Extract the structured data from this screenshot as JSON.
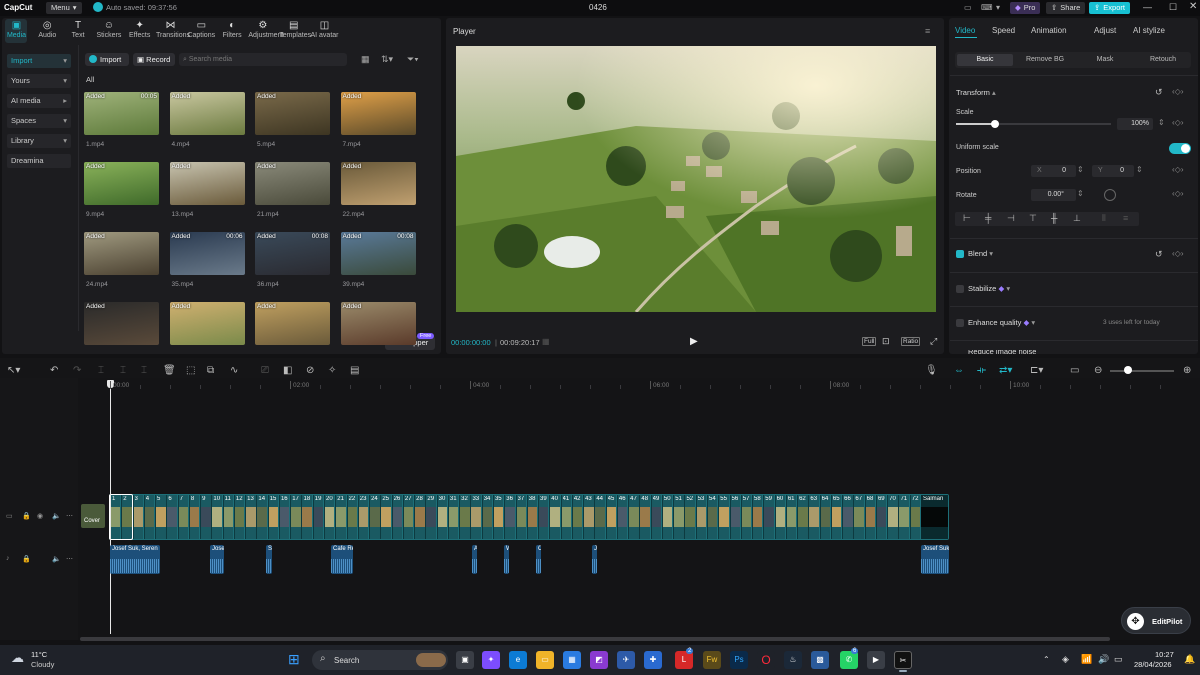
{
  "titlebar": {
    "logo": "CapCut",
    "menu": "Menu",
    "autosave": "Auto saved: 09:37:56",
    "project": "0426",
    "pro": "Pro",
    "share": "Share",
    "export": "Export"
  },
  "toolbar": [
    {
      "label": "Media",
      "icon": "media-icon"
    },
    {
      "label": "Audio",
      "icon": "audio-icon"
    },
    {
      "label": "Text",
      "icon": "text-icon"
    },
    {
      "label": "Stickers",
      "icon": "stickers-icon"
    },
    {
      "label": "Effects",
      "icon": "effects-icon"
    },
    {
      "label": "Transitions",
      "icon": "transitions-icon"
    },
    {
      "label": "Captions",
      "icon": "captions-icon"
    },
    {
      "label": "Filters",
      "icon": "filters-icon"
    },
    {
      "label": "Adjustment",
      "icon": "adjustment-icon"
    },
    {
      "label": "Templates",
      "icon": "templates-icon"
    },
    {
      "label": "AI avatar",
      "icon": "ai-avatar-icon"
    }
  ],
  "leftnav": [
    "Import",
    "Yours",
    "AI media",
    "Spaces",
    "Library",
    "Dreamina"
  ],
  "media": {
    "import_btn": "Import",
    "record_btn": "Record",
    "search_placeholder": "Search media",
    "filter_all": "All",
    "ai_clipper": "AI clipper",
    "free_badge": "Free",
    "items": [
      {
        "name": "1.mp4",
        "tag": "Added",
        "dur": "00:05"
      },
      {
        "name": "4.mp4",
        "tag": "Added",
        "dur": ""
      },
      {
        "name": "5.mp4",
        "tag": "Added",
        "dur": ""
      },
      {
        "name": "7.mp4",
        "tag": "Added",
        "dur": ""
      },
      {
        "name": "9.mp4",
        "tag": "Added",
        "dur": ""
      },
      {
        "name": "13.mp4",
        "tag": "Added",
        "dur": ""
      },
      {
        "name": "21.mp4",
        "tag": "Added",
        "dur": ""
      },
      {
        "name": "22.mp4",
        "tag": "Added",
        "dur": ""
      },
      {
        "name": "24.mp4",
        "tag": "Added",
        "dur": ""
      },
      {
        "name": "35.mp4",
        "tag": "Added",
        "dur": "00:06"
      },
      {
        "name": "36.mp4",
        "tag": "Added",
        "dur": "00:08"
      },
      {
        "name": "39.mp4",
        "tag": "Added",
        "dur": "00:08"
      },
      {
        "name": "",
        "tag": "Added",
        "dur": ""
      },
      {
        "name": "",
        "tag": "Added",
        "dur": ""
      },
      {
        "name": "",
        "tag": "Added",
        "dur": ""
      },
      {
        "name": "",
        "tag": "Added",
        "dur": ""
      }
    ]
  },
  "player": {
    "title": "Player",
    "current": "00:00:00:00",
    "total": "00:09:20:17",
    "full": "Full",
    "ratio": "Ratio"
  },
  "props": {
    "tabs": [
      "Video",
      "Speed",
      "Animation",
      "Adjust",
      "AI stylize"
    ],
    "subtabs": [
      "Basic",
      "Remove BG",
      "Mask",
      "Retouch"
    ],
    "transform": "Transform",
    "scale_label": "Scale",
    "scale_value": "100%",
    "scale_level": 0.25,
    "uniform_scale": "Uniform scale",
    "position_label": "Position",
    "pos_x_label": "X",
    "pos_x": "0",
    "pos_y_label": "Y",
    "pos_y": "0",
    "rotate_label": "Rotate",
    "rotate_value": "0.00°",
    "blend": "Blend",
    "stabilize": "Stabilize",
    "enhance": "Enhance quality",
    "uses_left": "3 uses left for today",
    "reduce_noise": "Reduce image noise"
  },
  "timeline": {
    "ruler": [
      "00:00",
      "02:00",
      "04:00",
      "06:00",
      "08:00",
      "10:00"
    ],
    "cover": "Cover",
    "clip_numbers": [
      "1",
      "2",
      "3",
      "4",
      "5",
      "6",
      "7",
      "8",
      "9",
      "10",
      "11",
      "12",
      "13",
      "14",
      "15",
      "16",
      "17",
      "18",
      "19",
      "20",
      "21",
      "22",
      "23",
      "24",
      "25",
      "26",
      "27",
      "28",
      "29",
      "30",
      "31",
      "32",
      "33",
      "34",
      "35",
      "36",
      "37",
      "38",
      "39",
      "40",
      "41",
      "42",
      "43",
      "44",
      "45",
      "46",
      "47",
      "48",
      "49",
      "50",
      "51",
      "52",
      "53",
      "54",
      "55",
      "56",
      "57",
      "58",
      "59",
      "60",
      "61",
      "62",
      "63",
      "64",
      "65",
      "66",
      "67",
      "68",
      "69",
      "70",
      "71",
      "72"
    ],
    "last_clip": "Salman",
    "audio_clips": [
      "Josef Suk, Seren",
      "Jose",
      "S",
      "Cafe Re",
      "A",
      "W",
      "C",
      "J",
      "Josef Suk"
    ]
  },
  "editpilot": "EditPilot",
  "taskbar": {
    "temp": "11°C",
    "weather": "Cloudy",
    "search": "Search",
    "time": "10:27",
    "date": "28/04/2026",
    "badge_l": "2",
    "badge_wa": "6"
  }
}
